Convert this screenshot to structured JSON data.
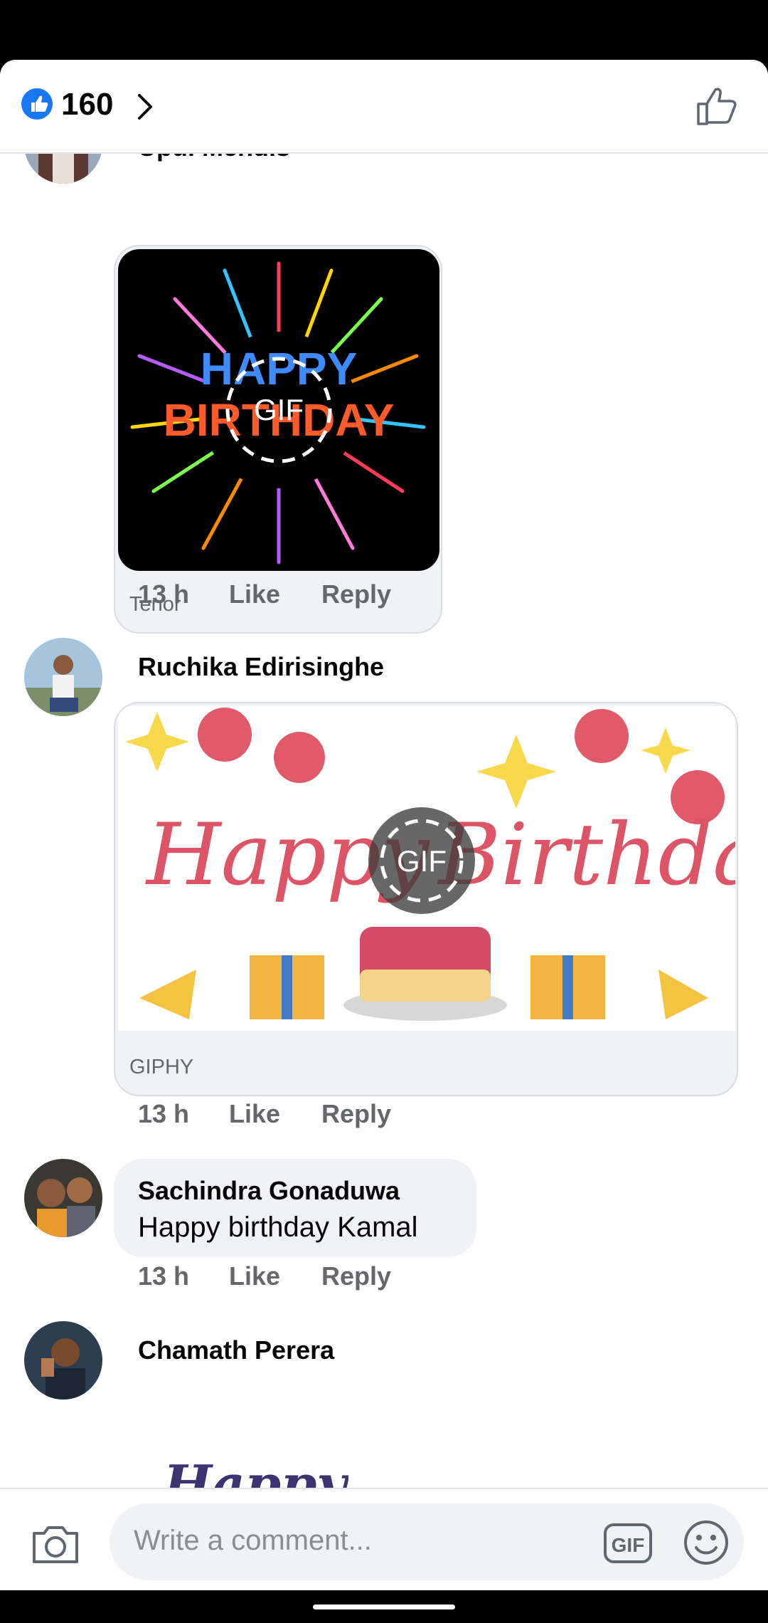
{
  "header": {
    "reaction_count": "160"
  },
  "comments": [
    {
      "author": "Upul Mendis",
      "media_source": "Tenor",
      "gif_label": "GIF",
      "time": "13 h",
      "like": "Like",
      "reply": "Reply"
    },
    {
      "author": "Ruchika Edirisinghe",
      "media_source": "GIPHY",
      "gif_label": "GIF",
      "time": "13 h",
      "like": "Like",
      "reply": "Reply"
    },
    {
      "author": "Sachindra Gonaduwa",
      "text": "Happy birthday Kamal",
      "time": "13 h",
      "like": "Like",
      "reply": "Reply"
    },
    {
      "author": "Chamath Perera"
    }
  ],
  "composer": {
    "placeholder": "Write a comment...",
    "gif_label": "GIF"
  },
  "colors": {
    "accent": "#1877f2",
    "secondary_text": "#65676b",
    "bubble": "#f0f2f5"
  },
  "icons": {
    "reaction": "like-reaction-icon",
    "open": "chevron-right-icon",
    "like": "thumbs-up-outline-icon",
    "camera": "camera-icon",
    "gif": "gif-icon",
    "emoji": "smiley-icon"
  }
}
